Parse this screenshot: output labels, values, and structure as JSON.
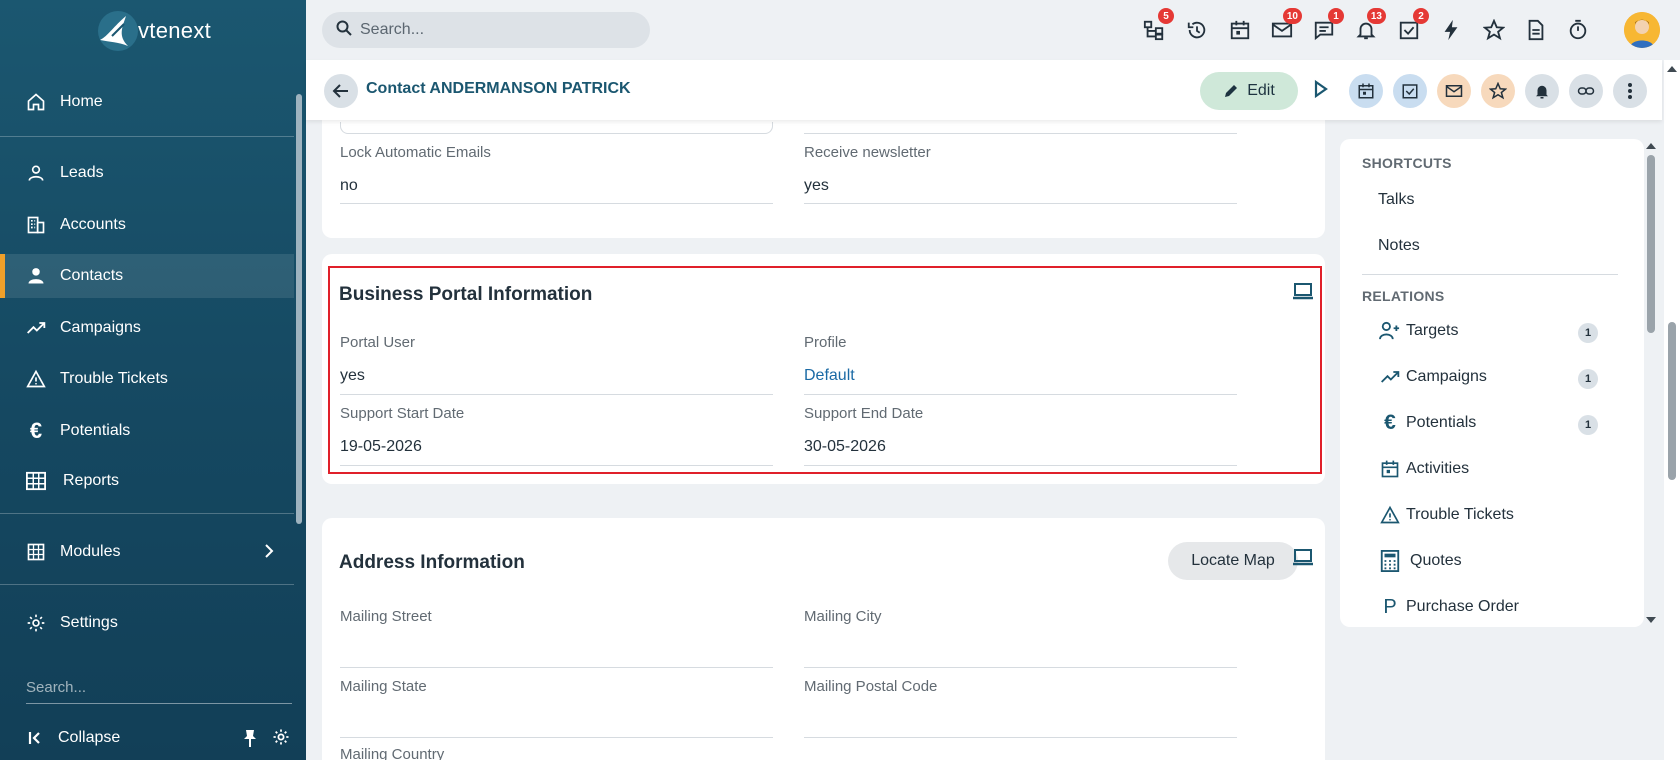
{
  "app": {
    "logo_text": "vtenext"
  },
  "colors": {
    "sidebar": "#1b5770",
    "accent": "#f0a02a",
    "badge": "#e53935",
    "highlight": "#e0202a",
    "link": "#1b6aa5"
  },
  "sidebar": {
    "items": [
      {
        "label": "Home",
        "icon": "home-icon"
      },
      {
        "label": "Leads",
        "icon": "user-outline-icon"
      },
      {
        "label": "Accounts",
        "icon": "building-icon"
      },
      {
        "label": "Contacts",
        "icon": "user-icon"
      },
      {
        "label": "Campaigns",
        "icon": "trend-icon"
      },
      {
        "label": "Trouble Tickets",
        "icon": "warning-icon"
      },
      {
        "label": "Potentials",
        "icon": "euro-icon"
      },
      {
        "label": "Reports",
        "icon": "table-icon"
      },
      {
        "label": "Modules",
        "icon": "grid-icon"
      },
      {
        "label": "Settings",
        "icon": "gear-icon"
      }
    ],
    "search_placeholder": "Search...",
    "collapse_label": "Collapse"
  },
  "topbar": {
    "search_placeholder": "Search...",
    "badges": {
      "hierarchy": "5",
      "mail": "10",
      "chat": "1",
      "bell": "13",
      "tasks": "2"
    }
  },
  "header": {
    "title": "Contact ANDERMANSON PATRICK",
    "edit_label": "Edit"
  },
  "sections": {
    "top": {
      "lock_label": "Lock Automatic Emails",
      "lock_value": "no",
      "newsletter_label": "Receive newsletter",
      "newsletter_value": "yes"
    },
    "portal": {
      "title": "Business Portal Information",
      "portal_user_label": "Portal User",
      "portal_user_value": "yes",
      "profile_label": "Profile",
      "profile_value": "Default",
      "start_label": "Support Start Date",
      "start_value": "19-05-2026",
      "end_label": "Support End Date",
      "end_value": "30-05-2026"
    },
    "address": {
      "title": "Address Information",
      "locate_label": "Locate Map",
      "street_label": "Mailing Street",
      "city_label": "Mailing City",
      "state_label": "Mailing State",
      "postal_label": "Mailing Postal Code",
      "country_label": "Mailing Country"
    }
  },
  "right_panel": {
    "shortcuts_head": "SHORTCUTS",
    "shortcuts": [
      "Talks",
      "Notes"
    ],
    "relations_head": "RELATIONS",
    "relations": [
      {
        "label": "Targets",
        "count": "1"
      },
      {
        "label": "Campaigns",
        "count": "1"
      },
      {
        "label": "Potentials",
        "count": "1"
      },
      {
        "label": "Activities"
      },
      {
        "label": "Trouble Tickets"
      },
      {
        "label": "Quotes"
      },
      {
        "label": "Purchase Order"
      }
    ]
  }
}
